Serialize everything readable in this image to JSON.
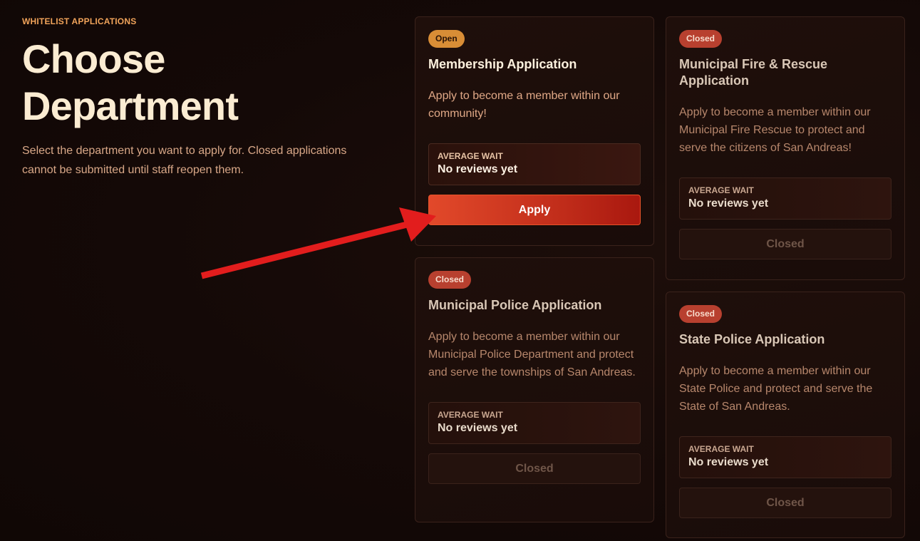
{
  "header": {
    "eyebrow": "WHITELIST APPLICATIONS",
    "title": "Choose Department",
    "subtitle": "Select the department you want to apply for. Closed applications cannot be submitted until staff reopen them."
  },
  "cards": [
    {
      "status": "Open",
      "title": "Membership Application",
      "description": "Apply to become a member within our community!",
      "wait_label": "AVERAGE WAIT",
      "wait_value": "No reviews yet",
      "action_label": "Apply"
    },
    {
      "status": "Closed",
      "title": "Municipal Fire & Rescue Application",
      "description": "Apply to become a member within our Municipal Fire Rescue to protect and serve the citizens of San Andreas!",
      "wait_label": "AVERAGE WAIT",
      "wait_value": "No reviews yet",
      "action_label": "Closed"
    },
    {
      "status": "Closed",
      "title": "Municipal Police Application",
      "description": "Apply to become a member within our Municipal Police Department and protect and serve the townships of San Andreas.",
      "wait_label": "AVERAGE WAIT",
      "wait_value": "No reviews yet",
      "action_label": "Closed"
    },
    {
      "status": "Closed",
      "title": "State Police Application",
      "description": "Apply to become a member within our State Police and protect and serve the State of San Andreas.",
      "wait_label": "AVERAGE WAIT",
      "wait_value": "No reviews yet",
      "action_label": "Closed"
    }
  ],
  "colors": {
    "background": "#130907",
    "accent": "#e2492a",
    "open_badge": "#d88d36",
    "closed_badge": "#b8402f",
    "annotation_arrow": "#e21d1d"
  },
  "icons": {
    "annotation": "red-arrow-icon"
  }
}
